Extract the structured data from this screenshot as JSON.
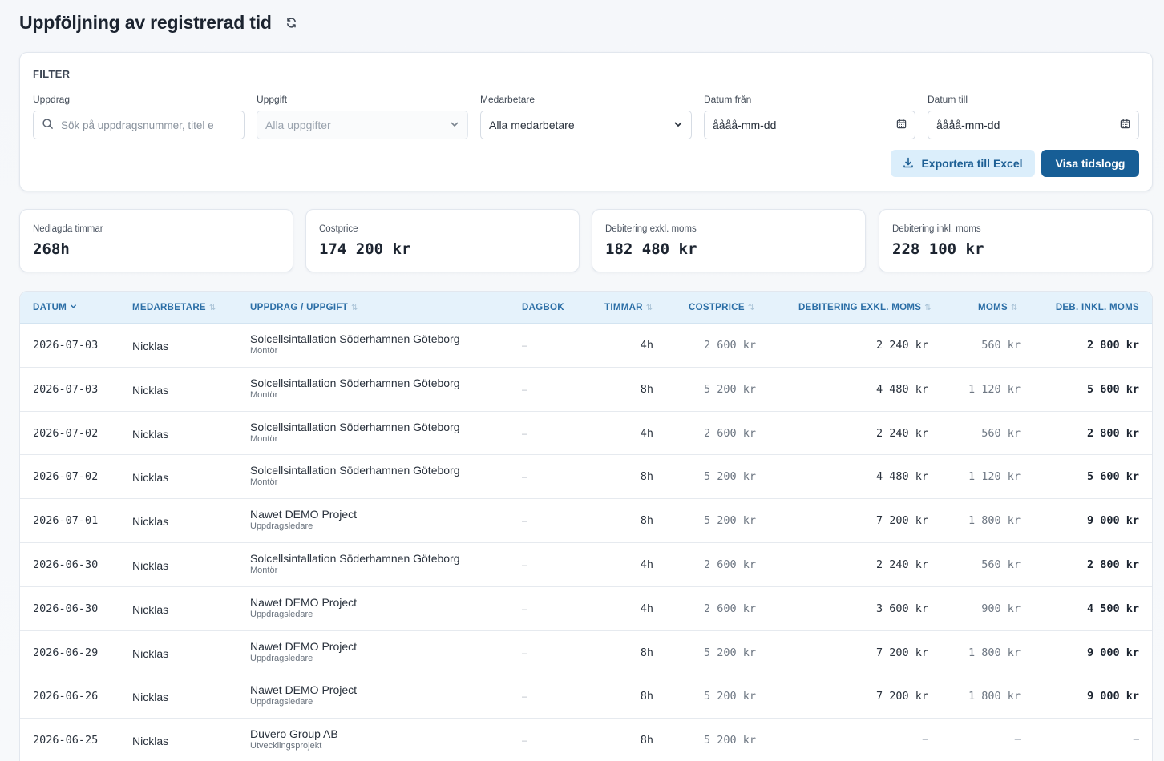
{
  "header": {
    "title": "Uppföljning av registrerad tid"
  },
  "filter": {
    "title": "FILTER",
    "uppdrag": {
      "label": "Uppdrag",
      "placeholder": "Sök på uppdragsnummer, titel e"
    },
    "uppgift": {
      "label": "Uppgift",
      "value": "Alla uppgifter"
    },
    "medarbetare": {
      "label": "Medarbetare",
      "value": "Alla medarbetare"
    },
    "datum_fran": {
      "label": "Datum från",
      "value": "åååå-mm-dd"
    },
    "datum_till": {
      "label": "Datum till",
      "value": "åååå-mm-dd"
    },
    "export_label": "Exportera till Excel",
    "primary_label": "Visa tidslogg"
  },
  "stats": [
    {
      "label": "Nedlagda timmar",
      "value": "268h"
    },
    {
      "label": "Costprice",
      "value": "174 200 kr"
    },
    {
      "label": "Debitering exkl. moms",
      "value": "182 480 kr"
    },
    {
      "label": "Debitering inkl. moms",
      "value": "228 100 kr"
    }
  ],
  "table": {
    "columns": [
      "DATUM",
      "MEDARBETARE",
      "UPPDRAG / UPPGIFT",
      "DAGBOK",
      "TIMMAR",
      "COSTPRICE",
      "DEBITERING EXKL. MOMS",
      "MOMS",
      "DEB. INKL. MOMS"
    ],
    "rows": [
      {
        "datum": "2026-07-03",
        "medarbetare": "Nicklas",
        "uppdrag": "Solcellsintallation Söderhamnen Göteborg",
        "uppgift": "Montör",
        "dagbok": "–",
        "timmar": "4h",
        "costprice": "2 600 kr",
        "exkl": "2 240 kr",
        "moms": "560 kr",
        "inkl": "2 800 kr"
      },
      {
        "datum": "2026-07-03",
        "medarbetare": "Nicklas",
        "uppdrag": "Solcellsintallation Söderhamnen Göteborg",
        "uppgift": "Montör",
        "dagbok": "–",
        "timmar": "8h",
        "costprice": "5 200 kr",
        "exkl": "4 480 kr",
        "moms": "1 120 kr",
        "inkl": "5 600 kr"
      },
      {
        "datum": "2026-07-02",
        "medarbetare": "Nicklas",
        "uppdrag": "Solcellsintallation Söderhamnen Göteborg",
        "uppgift": "Montör",
        "dagbok": "–",
        "timmar": "4h",
        "costprice": "2 600 kr",
        "exkl": "2 240 kr",
        "moms": "560 kr",
        "inkl": "2 800 kr"
      },
      {
        "datum": "2026-07-02",
        "medarbetare": "Nicklas",
        "uppdrag": "Solcellsintallation Söderhamnen Göteborg",
        "uppgift": "Montör",
        "dagbok": "–",
        "timmar": "8h",
        "costprice": "5 200 kr",
        "exkl": "4 480 kr",
        "moms": "1 120 kr",
        "inkl": "5 600 kr"
      },
      {
        "datum": "2026-07-01",
        "medarbetare": "Nicklas",
        "uppdrag": "Nawet DEMO Project",
        "uppgift": "Uppdragsledare",
        "dagbok": "–",
        "timmar": "8h",
        "costprice": "5 200 kr",
        "exkl": "7 200 kr",
        "moms": "1 800 kr",
        "inkl": "9 000 kr"
      },
      {
        "datum": "2026-06-30",
        "medarbetare": "Nicklas",
        "uppdrag": "Solcellsintallation Söderhamnen Göteborg",
        "uppgift": "Montör",
        "dagbok": "–",
        "timmar": "4h",
        "costprice": "2 600 kr",
        "exkl": "2 240 kr",
        "moms": "560 kr",
        "inkl": "2 800 kr"
      },
      {
        "datum": "2026-06-30",
        "medarbetare": "Nicklas",
        "uppdrag": "Nawet DEMO Project",
        "uppgift": "Uppdragsledare",
        "dagbok": "–",
        "timmar": "4h",
        "costprice": "2 600 kr",
        "exkl": "3 600 kr",
        "moms": "900 kr",
        "inkl": "4 500 kr"
      },
      {
        "datum": "2026-06-29",
        "medarbetare": "Nicklas",
        "uppdrag": "Nawet DEMO Project",
        "uppgift": "Uppdragsledare",
        "dagbok": "–",
        "timmar": "8h",
        "costprice": "5 200 kr",
        "exkl": "7 200 kr",
        "moms": "1 800 kr",
        "inkl": "9 000 kr"
      },
      {
        "datum": "2026-06-26",
        "medarbetare": "Nicklas",
        "uppdrag": "Nawet DEMO Project",
        "uppgift": "Uppdragsledare",
        "dagbok": "–",
        "timmar": "8h",
        "costprice": "5 200 kr",
        "exkl": "7 200 kr",
        "moms": "1 800 kr",
        "inkl": "9 000 kr"
      },
      {
        "datum": "2026-06-25",
        "medarbetare": "Nicklas",
        "uppdrag": "Duvero Group AB",
        "uppgift": "Utvecklingsprojekt",
        "dagbok": "–",
        "timmar": "8h",
        "costprice": "5 200 kr",
        "exkl": "–",
        "moms": "–",
        "inkl": "–"
      }
    ]
  },
  "icons": {
    "refresh": "refresh-icon",
    "search": "search-icon",
    "chevron": "chevron-down-icon",
    "calendar": "calendar-icon",
    "download": "download-icon",
    "sort": "sort-icon"
  },
  "colors": {
    "accent": "#175e96",
    "header_bg": "#e5f2fb",
    "header_text": "#2b6ea6",
    "export_bg": "#dbeefb"
  }
}
